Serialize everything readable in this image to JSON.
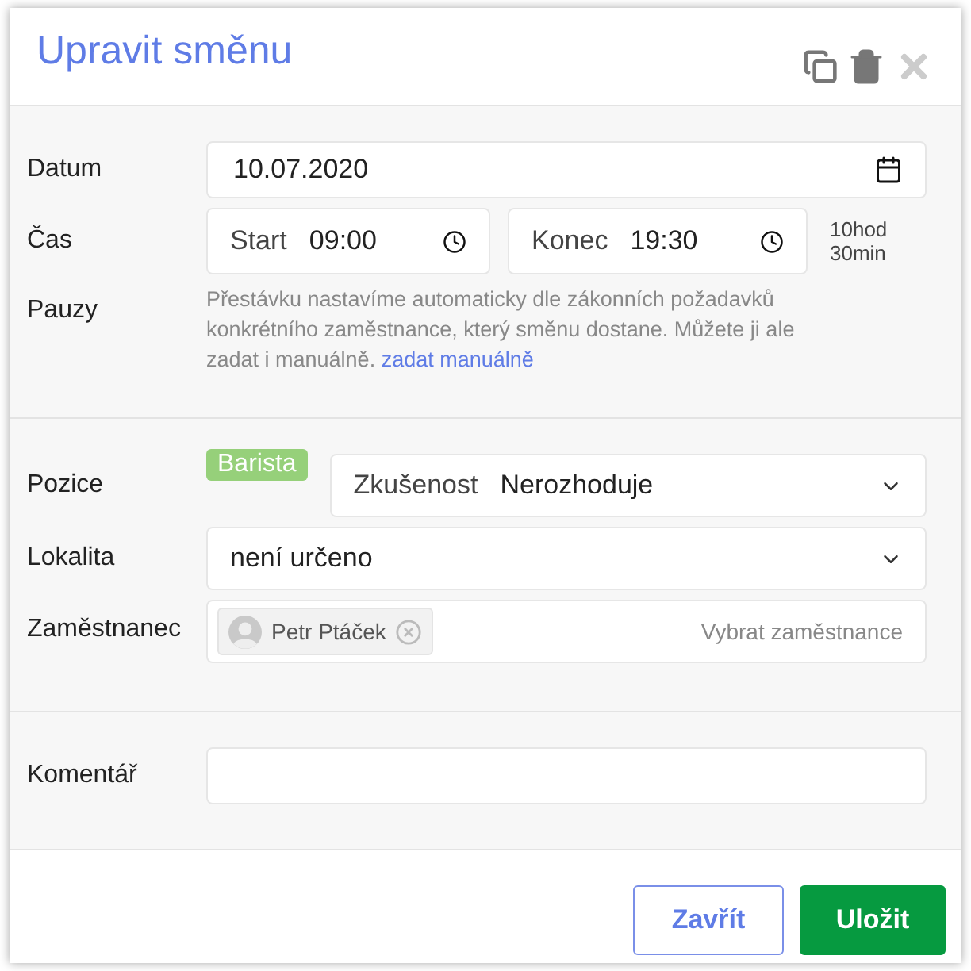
{
  "dialog": {
    "title": "Upravit směnu"
  },
  "date": {
    "label": "Datum",
    "value": "10.07.2020"
  },
  "time": {
    "label": "Čas",
    "start_label": "Start",
    "start": "09:00",
    "end_label": "Konec",
    "end": "19:30",
    "duration": [
      "10hod",
      "30min"
    ]
  },
  "breaks": {
    "label": "Pauzy",
    "note": "Přestávku nastavíme automaticky dle zákonních požadavků konkrétního zaměstnance, který směnu dostane. Můžete ji ale zadat i manuálně.",
    "link": "zadat manuálně"
  },
  "position": {
    "label": "Pozice",
    "tag": {
      "label": "Barista",
      "color": "#96d07a"
    },
    "experience_label": "Zkušenost",
    "experience": "Nerozhoduje"
  },
  "location": {
    "label": "Lokalita",
    "value": "není určeno"
  },
  "employee": {
    "label": "Zaměstnanec",
    "chips": [
      {
        "name": "Petr Ptáček"
      }
    ],
    "placeholder": "Vybrat zaměstnance"
  },
  "comment": {
    "label": "Komentář"
  },
  "buttons": [
    {
      "label": "Zavřít",
      "kind": "secondary"
    },
    {
      "label": "Uložit",
      "kind": "primary"
    }
  ]
}
